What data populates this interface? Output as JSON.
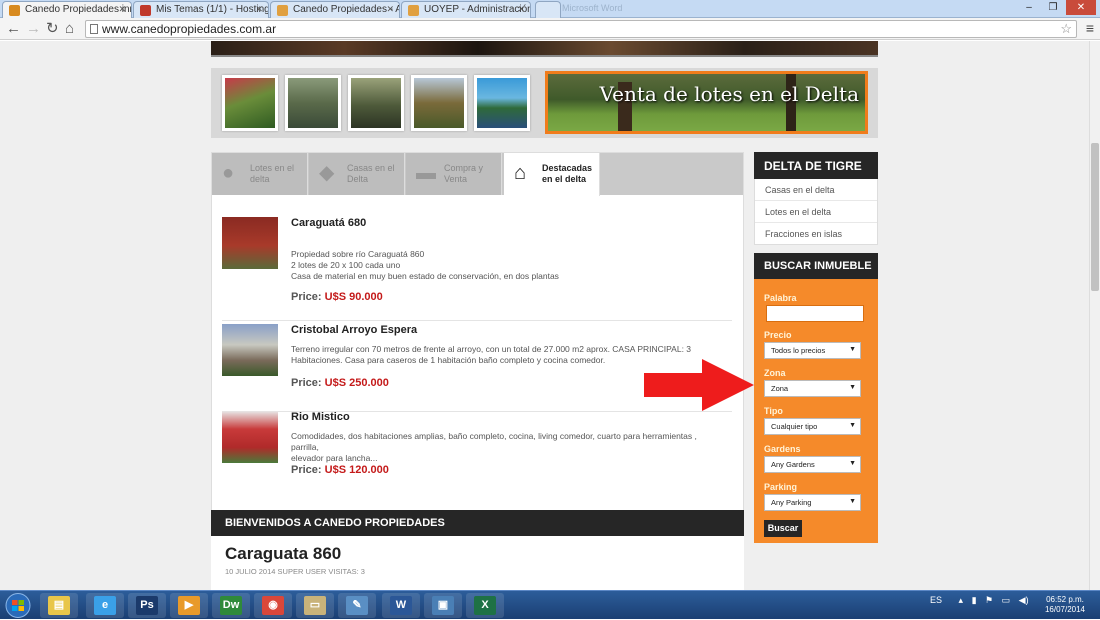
{
  "browser": {
    "tabs": [
      {
        "label": "Canedo Propiedades inm",
        "active": true,
        "favicon_color": "#d88a1f"
      },
      {
        "label": "Mis Temas (1/1) - Hosting",
        "active": false,
        "favicon_color": "#c0392b"
      },
      {
        "label": "Canedo Propiedades - Ad",
        "active": false,
        "favicon_color": "#e0a040"
      },
      {
        "label": "UOYEP - Administración",
        "active": false,
        "favicon_color": "#e0a040"
      },
      {
        "label": "",
        "active": false,
        "favicon_color": "#cccccc"
      }
    ],
    "ghost_tab_label": "Microsoft Word",
    "url": "www.canedopropiedades.com.ar",
    "window_controls": {
      "minimize": "–",
      "maximize": "❐",
      "close": "✕"
    }
  },
  "promo": {
    "text": "Venta de lotes en el Delta"
  },
  "content_tabs": [
    {
      "line1": "Lotes en el",
      "line2": "delta",
      "icon": "person-icon",
      "active": false
    },
    {
      "line1": "Casas en el",
      "line2": "Delta",
      "icon": "tag-icon",
      "active": false
    },
    {
      "line1": "Compra y",
      "line2": "Venta",
      "icon": "chat-icon",
      "active": false
    },
    {
      "line1": "Destacadas",
      "line2": "en el delta",
      "icon": "home-icon",
      "active": true
    }
  ],
  "listings": [
    {
      "title": "Caraguatá 680",
      "desc": [
        "Propiedad sobre río Caraguatá 860",
        "2 lotes de 20 x 100 cada uno",
        "Casa de material en muy buen estado de conservación, en dos plantas"
      ],
      "price_label": "Price:",
      "price_value": "U$S 90.000"
    },
    {
      "title": "Cristobal Arroyo Espera",
      "desc": [
        "Terreno irregular con 70 metros de frente al arroyo, con un total de 27.000 m2 aprox. CASA PRINCIPAL: 3",
        "Habitaciones. Casa para caseros de 1 habitación baño completo y cocina comedor."
      ],
      "price_label": "Price:",
      "price_value": "U$S 250.000"
    },
    {
      "title": "Rio Mistico",
      "desc": [
        "Comodidades, dos habitaciones amplias, baño completo, cocina, living comedor, cuarto para herramientas ,  parrilla,",
        "elevador para lancha..."
      ],
      "price_label": "Price:",
      "price_value": "U$S 120.000"
    }
  ],
  "welcome": {
    "heading": "BIENVENIDOS A CANEDO PROPIEDADES"
  },
  "article": {
    "title": "Caraguata 860",
    "meta": "10 JULIO 2014   SUPER USER   VISITAS: 3"
  },
  "sidebar": {
    "delta_heading": "DELTA DE TIGRE",
    "delta_items": [
      "Casas en el delta",
      "Lotes en el delta",
      "Fracciones en islas"
    ],
    "search_heading": "BUSCAR INMUEBLE",
    "search": {
      "palabra_label": "Palabra",
      "palabra_value": "",
      "precio_label": "Precio",
      "precio_value": "Todos lo precios",
      "zona_label": "Zona",
      "zona_value": "Zona",
      "tipo_label": "Tipo",
      "tipo_value": "Cualquier tipo",
      "gardens_label": "Gardens",
      "gardens_value": "Any Gardens",
      "parking_label": "Parking",
      "parking_value": "Any Parking",
      "submit_label": "Buscar"
    }
  },
  "taskbar": {
    "apps": [
      {
        "name": "file-explorer",
        "glyph": "▤",
        "color": "#e8c64a"
      },
      {
        "name": "internet-explorer",
        "glyph": "e",
        "color": "#3aa0e8"
      },
      {
        "name": "photoshop",
        "glyph": "Ps",
        "color": "#1b3a6b"
      },
      {
        "name": "media-player",
        "glyph": "▶",
        "color": "#e89a2a"
      },
      {
        "name": "dreamweaver",
        "glyph": "Dw",
        "color": "#2f8a3a"
      },
      {
        "name": "chrome",
        "glyph": "◉",
        "color": "#d9473a"
      },
      {
        "name": "folder",
        "glyph": "▭",
        "color": "#c9b37a"
      },
      {
        "name": "notepad",
        "glyph": "✎",
        "color": "#5a8fc4"
      },
      {
        "name": "word",
        "glyph": "W",
        "color": "#2b5797"
      },
      {
        "name": "window-manager",
        "glyph": "▣",
        "color": "#4a7fb5"
      },
      {
        "name": "excel",
        "glyph": "X",
        "color": "#1e7145"
      }
    ],
    "language": "ES",
    "time": "06:52 p.m.",
    "date": "16/07/2014"
  }
}
